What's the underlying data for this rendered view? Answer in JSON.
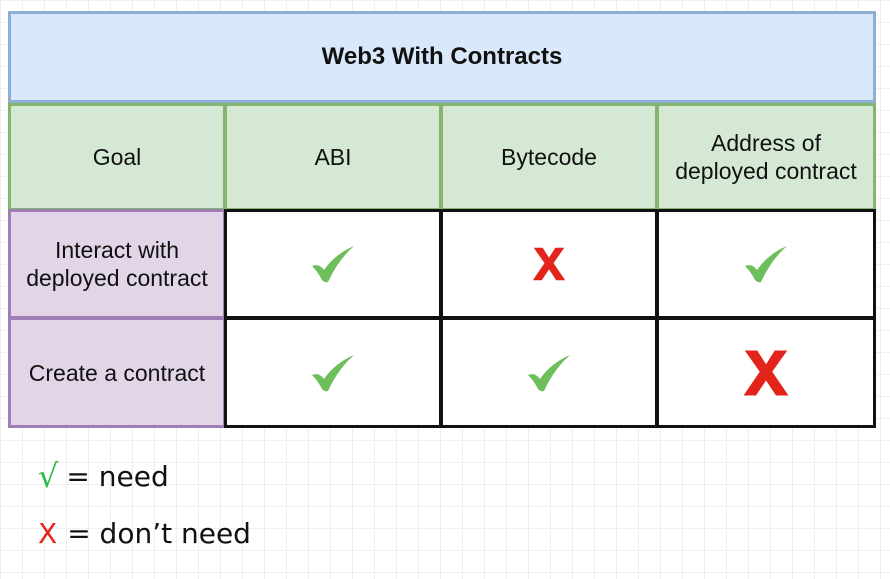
{
  "table": {
    "title": "Web3 With Contracts",
    "headers": {
      "goal": "Goal",
      "abi": "ABI",
      "bytecode": "Bytecode",
      "address_line1": "Address of",
      "address_line2": "deployed contract"
    },
    "rows": [
      {
        "goal_line1": "Interact with",
        "goal_line2": "deployed contract",
        "abi": "need",
        "bytecode": "don't need",
        "address": "need"
      },
      {
        "goal_line1": "Create a contract",
        "goal_line2": "",
        "abi": "need",
        "bytecode": "need",
        "address": "don't need"
      }
    ]
  },
  "legend": {
    "need_symbol": "√",
    "need_text": "= need",
    "dont_need_symbol": "X",
    "dont_need_text": "= don’t need"
  },
  "colors": {
    "check": "#6cbf5a",
    "cross": "#e3241b",
    "title_fill": "#dae8fc",
    "header_fill": "#d5e8d4",
    "goal_fill": "#e1d5e7"
  },
  "icons": {
    "need": "check-mark-icon",
    "dont_need": "x-mark-icon"
  }
}
